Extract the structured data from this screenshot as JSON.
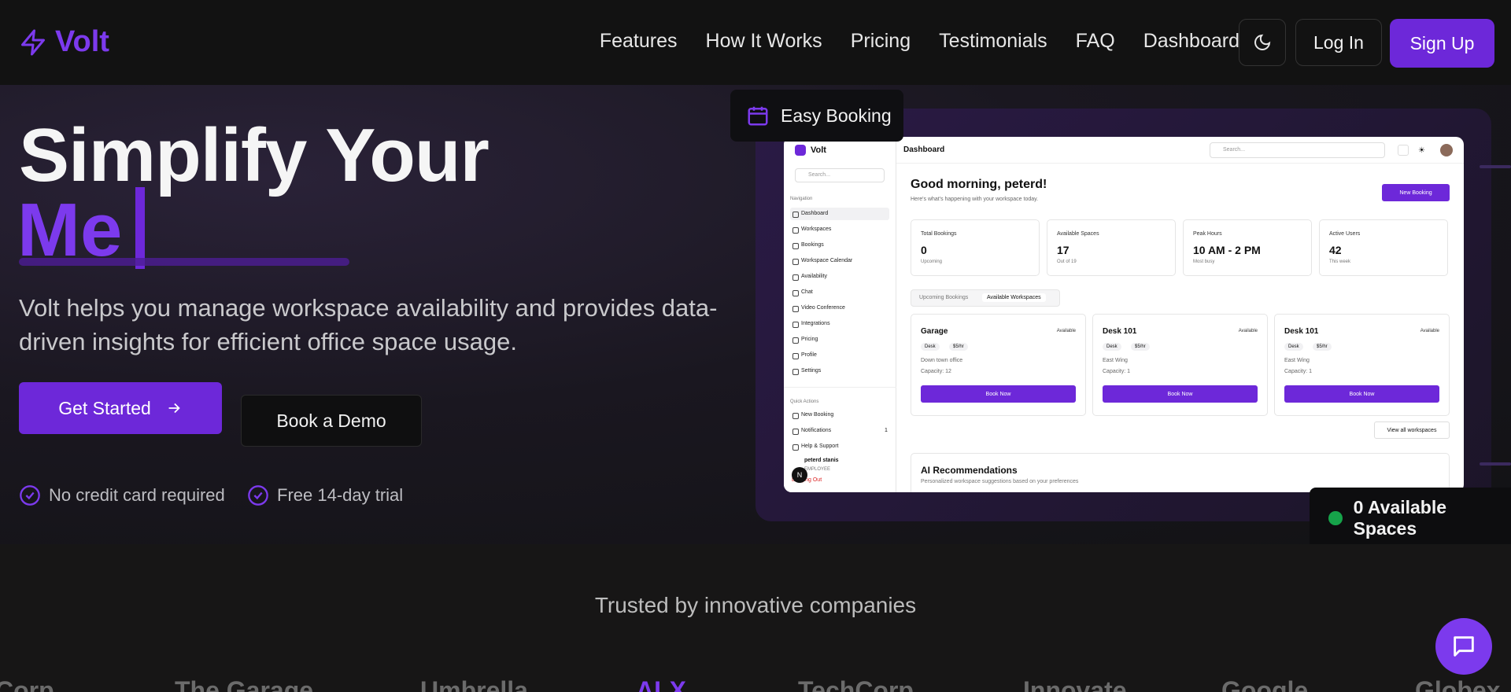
{
  "brand": {
    "name": "Volt",
    "color": "#7c3aed",
    "icon": "lightning-bolt-icon"
  },
  "nav": {
    "links": [
      "Features",
      "How It Works",
      "Pricing",
      "Testimonials",
      "FAQ",
      "Dashboard"
    ],
    "theme_icon": "moon-icon",
    "login": "Log In",
    "signup": "Sign Up"
  },
  "hero": {
    "headline": "Simplify Your",
    "typed": "Me",
    "description": "Volt helps you manage workspace availability and provides data-driven insights for efficient office space usage.",
    "cta_primary": "Get Started",
    "cta_secondary": "Book a Demo",
    "perks": [
      "No credit card required",
      "Free 14-day trial"
    ]
  },
  "floating": {
    "booking": "Easy Booking",
    "spaces": "0 Available Spaces"
  },
  "mockup": {
    "brand": "Volt",
    "search": "Search...",
    "nav_label": "Navigation",
    "nav_items": [
      "Dashboard",
      "Workspaces",
      "Bookings",
      "Workspace Calendar",
      "Availability",
      "Chat",
      "Video Conference",
      "Integrations",
      "Pricing",
      "Profile",
      "Settings"
    ],
    "quick_label": "Quick Actions",
    "quick_items": [
      "New Booking",
      "Notifications",
      "Help & Support"
    ],
    "notif_count": "1",
    "user_name": "peterd stanis",
    "user_role": "EMPLOYEE",
    "logging_out": "Logging Out",
    "title": "Dashboard",
    "greeting": "Good morning, peterd!",
    "greeting_sub": "Here's what's happening with your workspace today.",
    "new_booking": "New Booking",
    "stats": [
      {
        "title": "Total Bookings",
        "value": "0",
        "sub": "Upcoming"
      },
      {
        "title": "Available Spaces",
        "value": "17",
        "sub": "Out of 19"
      },
      {
        "title": "Peak Hours",
        "value": "10 AM - 2 PM",
        "sub": "Most busy"
      },
      {
        "title": "Active Users",
        "value": "42",
        "sub": "This week"
      }
    ],
    "tabs": [
      "Upcoming Bookings",
      "Available Workspaces"
    ],
    "workspaces": [
      {
        "name": "Garage",
        "status": "Available",
        "type": "Desk",
        "price": "$5/hr",
        "location": "Down town office",
        "capacity": "Capacity: 12",
        "action": "Book Now"
      },
      {
        "name": "Desk 101",
        "status": "Available",
        "type": "Desk",
        "price": "$5/hr",
        "location": "East Wing",
        "capacity": "Capacity: 1",
        "action": "Book Now"
      },
      {
        "name": "Desk 101",
        "status": "Available",
        "type": "Desk",
        "price": "$5/hr",
        "location": "East Wing",
        "capacity": "Capacity: 1",
        "action": "Book Now"
      }
    ],
    "view_all": "View all workspaces",
    "ai_title": "AI Recommendations",
    "ai_sub": "Personalized workspace suggestions based on your preferences"
  },
  "trusted": {
    "title": "Trusted by innovative companies",
    "logos": [
      "Corp",
      "The Garage",
      "Umbrella",
      "ALX",
      "TechCorp",
      "Innovate",
      "Google",
      "Globex"
    ]
  },
  "chat_icon": "chat-bubble-icon"
}
